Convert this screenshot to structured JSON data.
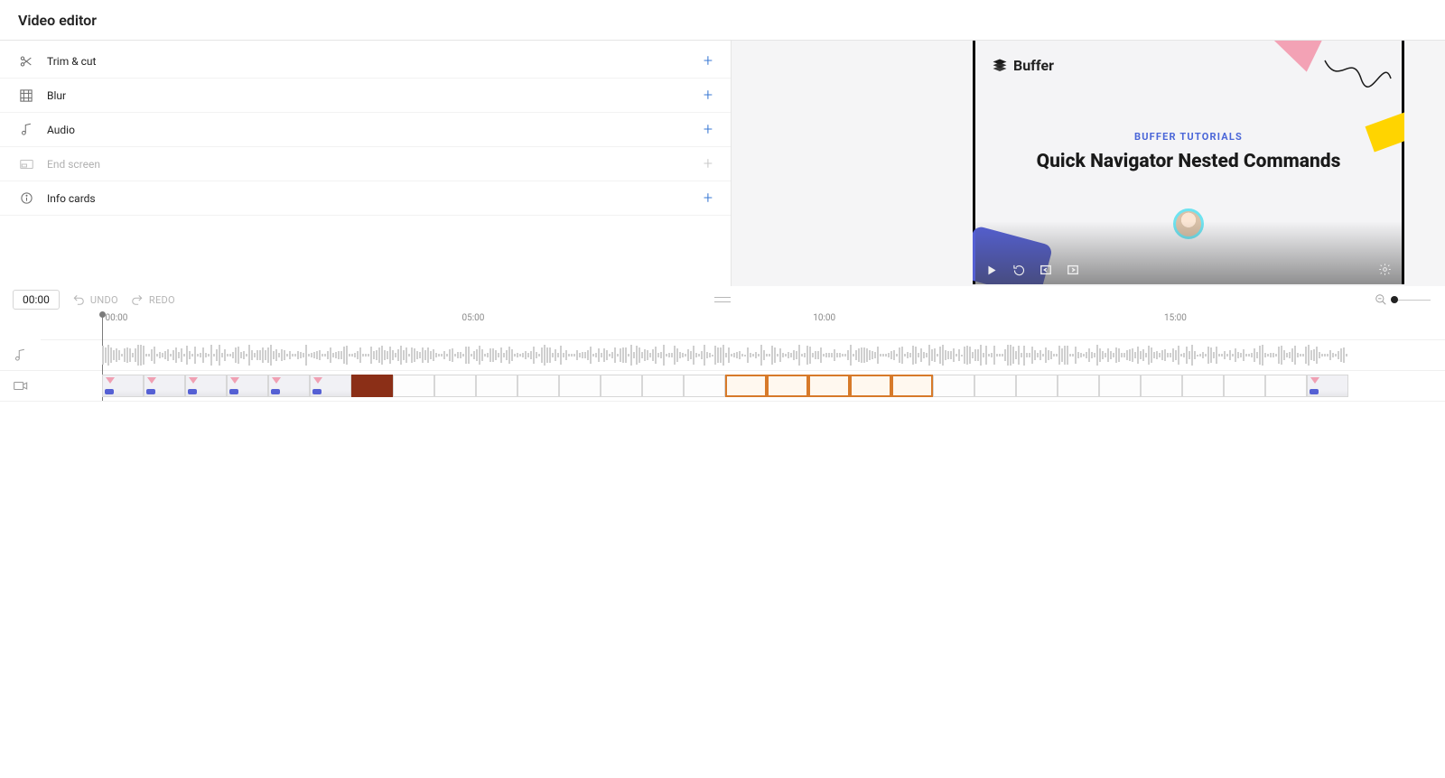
{
  "header": {
    "title": "Video editor"
  },
  "tools": [
    {
      "id": "trim",
      "label": "Trim & cut",
      "enabled": true,
      "icon": "scissors-icon"
    },
    {
      "id": "blur",
      "label": "Blur",
      "enabled": true,
      "icon": "blur-icon"
    },
    {
      "id": "audio",
      "label": "Audio",
      "enabled": true,
      "icon": "audio-icon"
    },
    {
      "id": "end",
      "label": "End screen",
      "enabled": false,
      "icon": "endscreen-icon"
    },
    {
      "id": "info",
      "label": "Info cards",
      "enabled": true,
      "icon": "info-icon"
    }
  ],
  "preview": {
    "brand": "Buffer",
    "subtitle": "BUFFER TUTORIALS",
    "title": "Quick Navigator Nested Commands"
  },
  "timeline": {
    "current_time": "00:00",
    "undo_label": "UNDO",
    "redo_label": "REDO",
    "marks": [
      {
        "label": "00:00",
        "pct": 4.6
      },
      {
        "label": "05:00",
        "pct": 30
      },
      {
        "label": "10:00",
        "pct": 55
      },
      {
        "label": "15:00",
        "pct": 80
      }
    ]
  }
}
